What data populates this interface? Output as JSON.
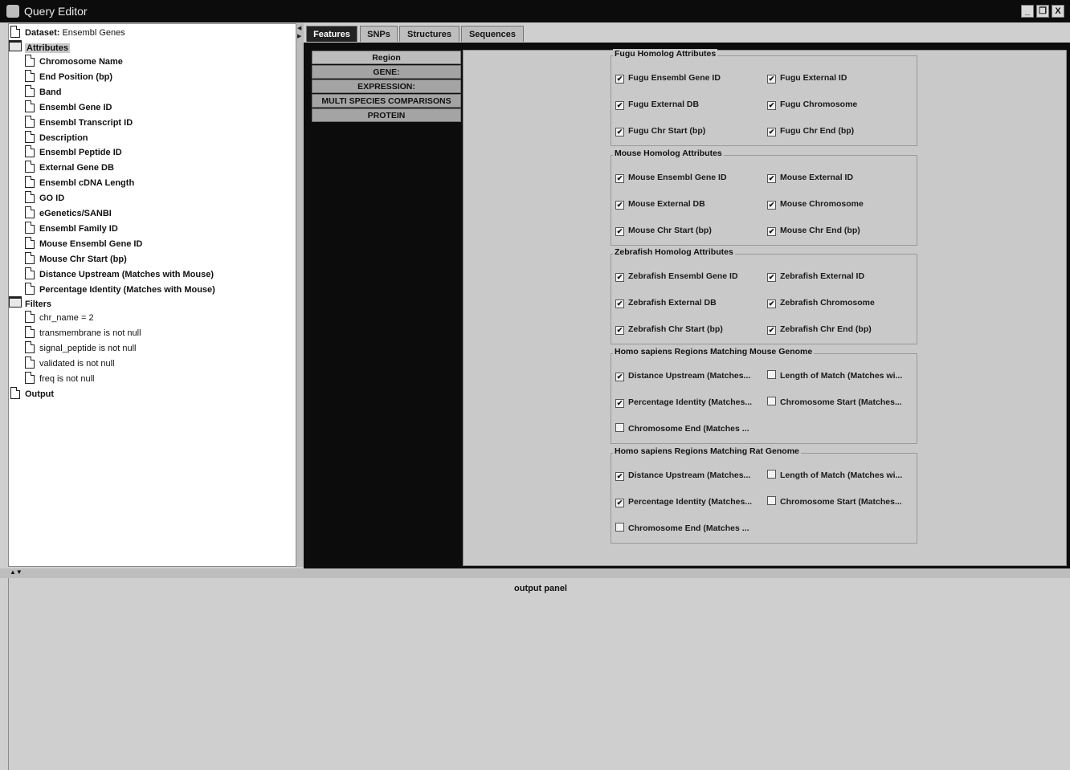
{
  "window": {
    "title": "Query Editor",
    "buttons": {
      "minimize": "_",
      "restore": "❐",
      "close": "X"
    }
  },
  "tree": {
    "dataset_label": "Dataset:",
    "dataset_value": "Ensembl Genes",
    "attributes_label": "Attributes",
    "attributes": [
      "Chromosome Name",
      "End Position (bp)",
      "Band",
      "Ensembl Gene ID",
      "Ensembl Transcript ID",
      "Description",
      "Ensembl Peptide ID",
      "External Gene DB",
      "Ensembl cDNA Length",
      "GO ID",
      "eGenetics/SANBI",
      "Ensembl Family ID",
      "Mouse Ensembl Gene ID",
      "Mouse Chr Start (bp)",
      "Distance Upstream (Matches with Mouse)",
      "Percentage Identity (Matches with Mouse)"
    ],
    "filters_label": "Filters",
    "filters": [
      "chr_name = 2",
      "transmembrane is not null",
      "signal_peptide is not null",
      "validated is not null",
      "freq is not null"
    ],
    "output_label": "Output"
  },
  "tabs": [
    "Features",
    "SNPs",
    "Structures",
    "Sequences"
  ],
  "subnav": [
    "Region",
    "GENE:",
    "EXPRESSION:",
    "MULTI SPECIES COMPARISONS",
    "PROTEIN"
  ],
  "groups": [
    {
      "title": "Fugu Homolog Attributes",
      "items": [
        {
          "label": "Fugu Ensembl Gene ID",
          "checked": true
        },
        {
          "label": "Fugu External ID",
          "checked": true
        },
        {
          "label": "Fugu External DB",
          "checked": true
        },
        {
          "label": "Fugu Chromosome",
          "checked": true
        },
        {
          "label": "Fugu Chr Start (bp)",
          "checked": true
        },
        {
          "label": "Fugu Chr End (bp)",
          "checked": true
        }
      ]
    },
    {
      "title": "Mouse Homolog Attributes",
      "items": [
        {
          "label": "Mouse Ensembl Gene ID",
          "checked": true
        },
        {
          "label": "Mouse External ID",
          "checked": true
        },
        {
          "label": "Mouse External DB",
          "checked": true
        },
        {
          "label": "Mouse Chromosome",
          "checked": true
        },
        {
          "label": "Mouse Chr Start (bp)",
          "checked": true
        },
        {
          "label": "Mouse Chr End (bp)",
          "checked": true
        }
      ]
    },
    {
      "title": "Zebrafish Homolog Attributes",
      "items": [
        {
          "label": "Zebrafish Ensembl Gene ID",
          "checked": true
        },
        {
          "label": "Zebrafish External ID",
          "checked": true
        },
        {
          "label": "Zebrafish External DB",
          "checked": true
        },
        {
          "label": "Zebrafish Chromosome",
          "checked": true
        },
        {
          "label": "Zebrafish Chr Start (bp)",
          "checked": true
        },
        {
          "label": "Zebrafish Chr End (bp)",
          "checked": true
        }
      ]
    },
    {
      "title": "Homo sapiens Regions Matching Mouse Genome",
      "items": [
        {
          "label": "Distance Upstream (Matches...",
          "checked": true
        },
        {
          "label": "Length of Match (Matches wi...",
          "checked": false
        },
        {
          "label": "Percentage Identity (Matches...",
          "checked": true
        },
        {
          "label": "Chromosome Start (Matches...",
          "checked": false
        },
        {
          "label": "Chromosome End (Matches ...",
          "checked": false
        }
      ]
    },
    {
      "title": "Homo sapiens Regions Matching Rat Genome",
      "items": [
        {
          "label": "Distance Upstream (Matches...",
          "checked": true
        },
        {
          "label": "Length of Match (Matches wi...",
          "checked": false
        },
        {
          "label": "Percentage Identity (Matches...",
          "checked": true
        },
        {
          "label": "Chromosome Start (Matches...",
          "checked": false
        },
        {
          "label": "Chromosome End (Matches ...",
          "checked": false
        }
      ]
    }
  ],
  "output_panel": {
    "label": "output panel"
  }
}
